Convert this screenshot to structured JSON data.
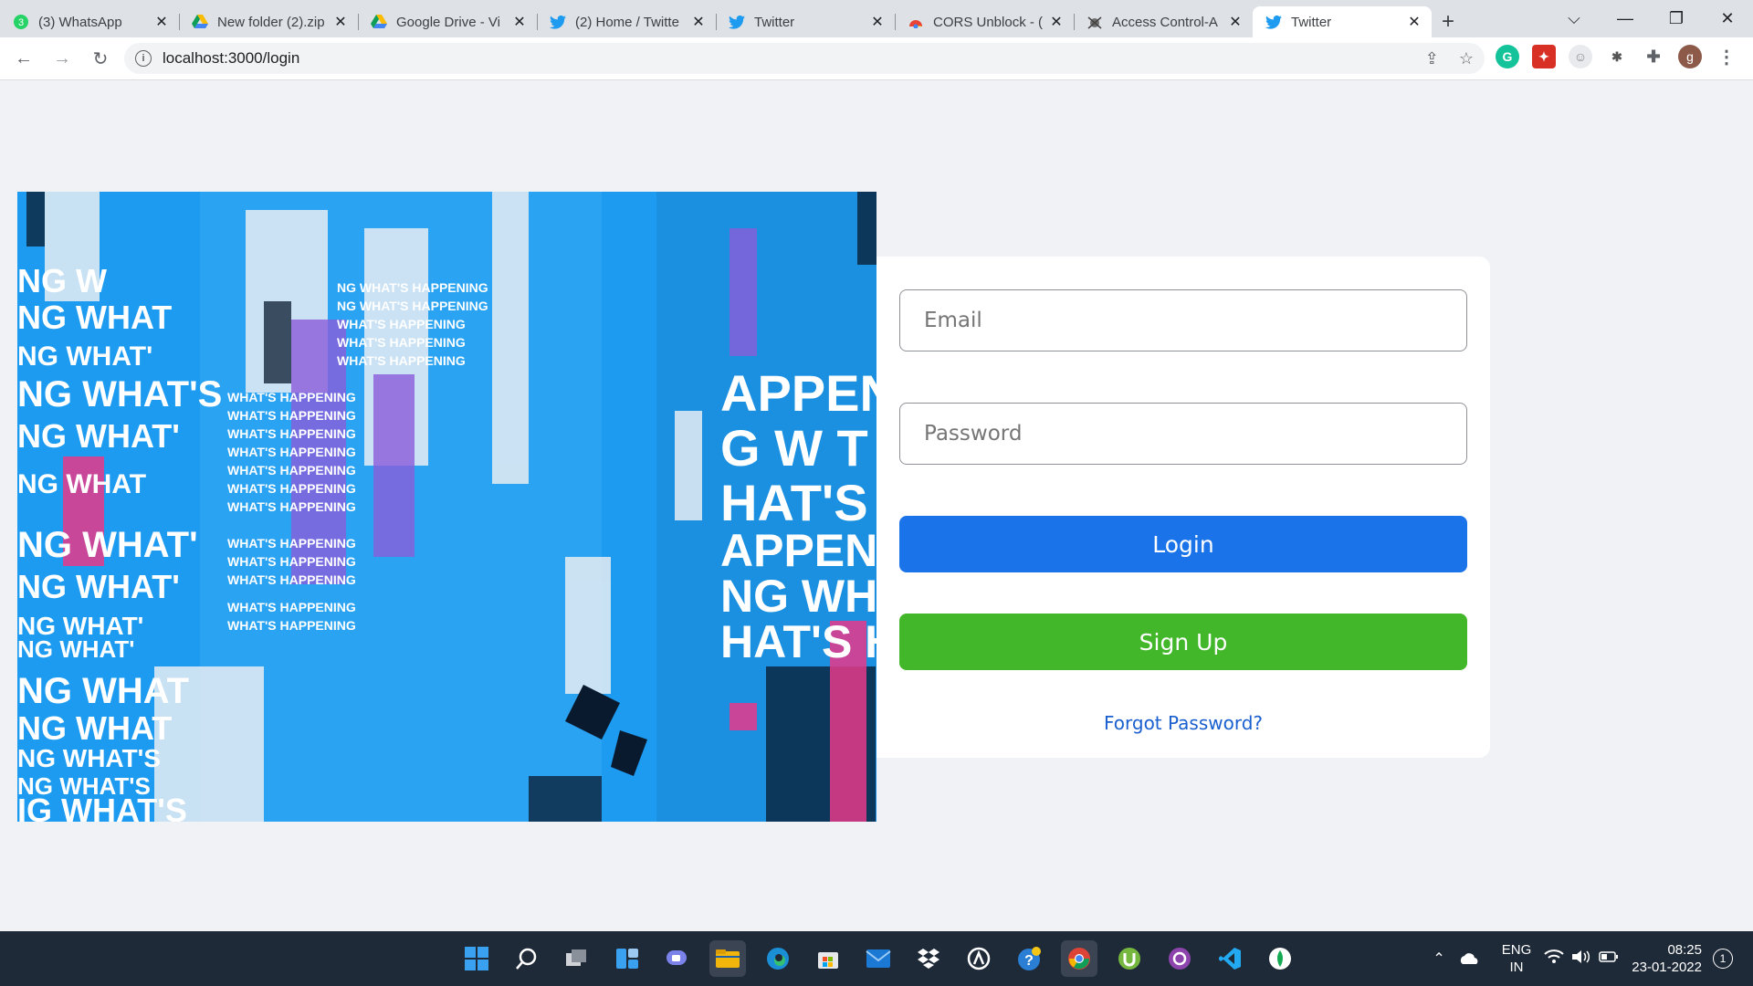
{
  "tabs": [
    {
      "title": "(3) WhatsApp",
      "icon": "whatsapp-icon",
      "badge": "3"
    },
    {
      "title": "New folder (2).zip",
      "icon": "google-drive-icon"
    },
    {
      "title": "Google Drive - Vi",
      "icon": "google-drive-icon"
    },
    {
      "title": "(2) Home / Twitte",
      "icon": "twitter-icon"
    },
    {
      "title": "Twitter",
      "icon": "twitter-icon"
    },
    {
      "title": "CORS Unblock - (",
      "icon": "chrome-webstore-icon"
    },
    {
      "title": "Access Control-A",
      "icon": "bug-icon"
    },
    {
      "title": "Twitter",
      "icon": "twitter-icon",
      "active": true
    }
  ],
  "address": {
    "url": "localhost:3000/login"
  },
  "profile": {
    "initial": "g"
  },
  "login_form": {
    "email_placeholder": "Email",
    "password_placeholder": "Password",
    "login_label": "Login",
    "signup_label": "Sign Up",
    "forgot_label": "Forgot Password?"
  },
  "colors": {
    "login": "#1a73e8",
    "signup": "#42b72a",
    "twitter": "#1d9bf0",
    "link": "#1a5fcf"
  },
  "hero": {
    "text": "WHAT'S HAPPENING"
  },
  "taskbar": {
    "lang_line1": "ENG",
    "lang_line2": "IN",
    "time": "08:25",
    "date": "23-01-2022",
    "notification_count": "1"
  }
}
